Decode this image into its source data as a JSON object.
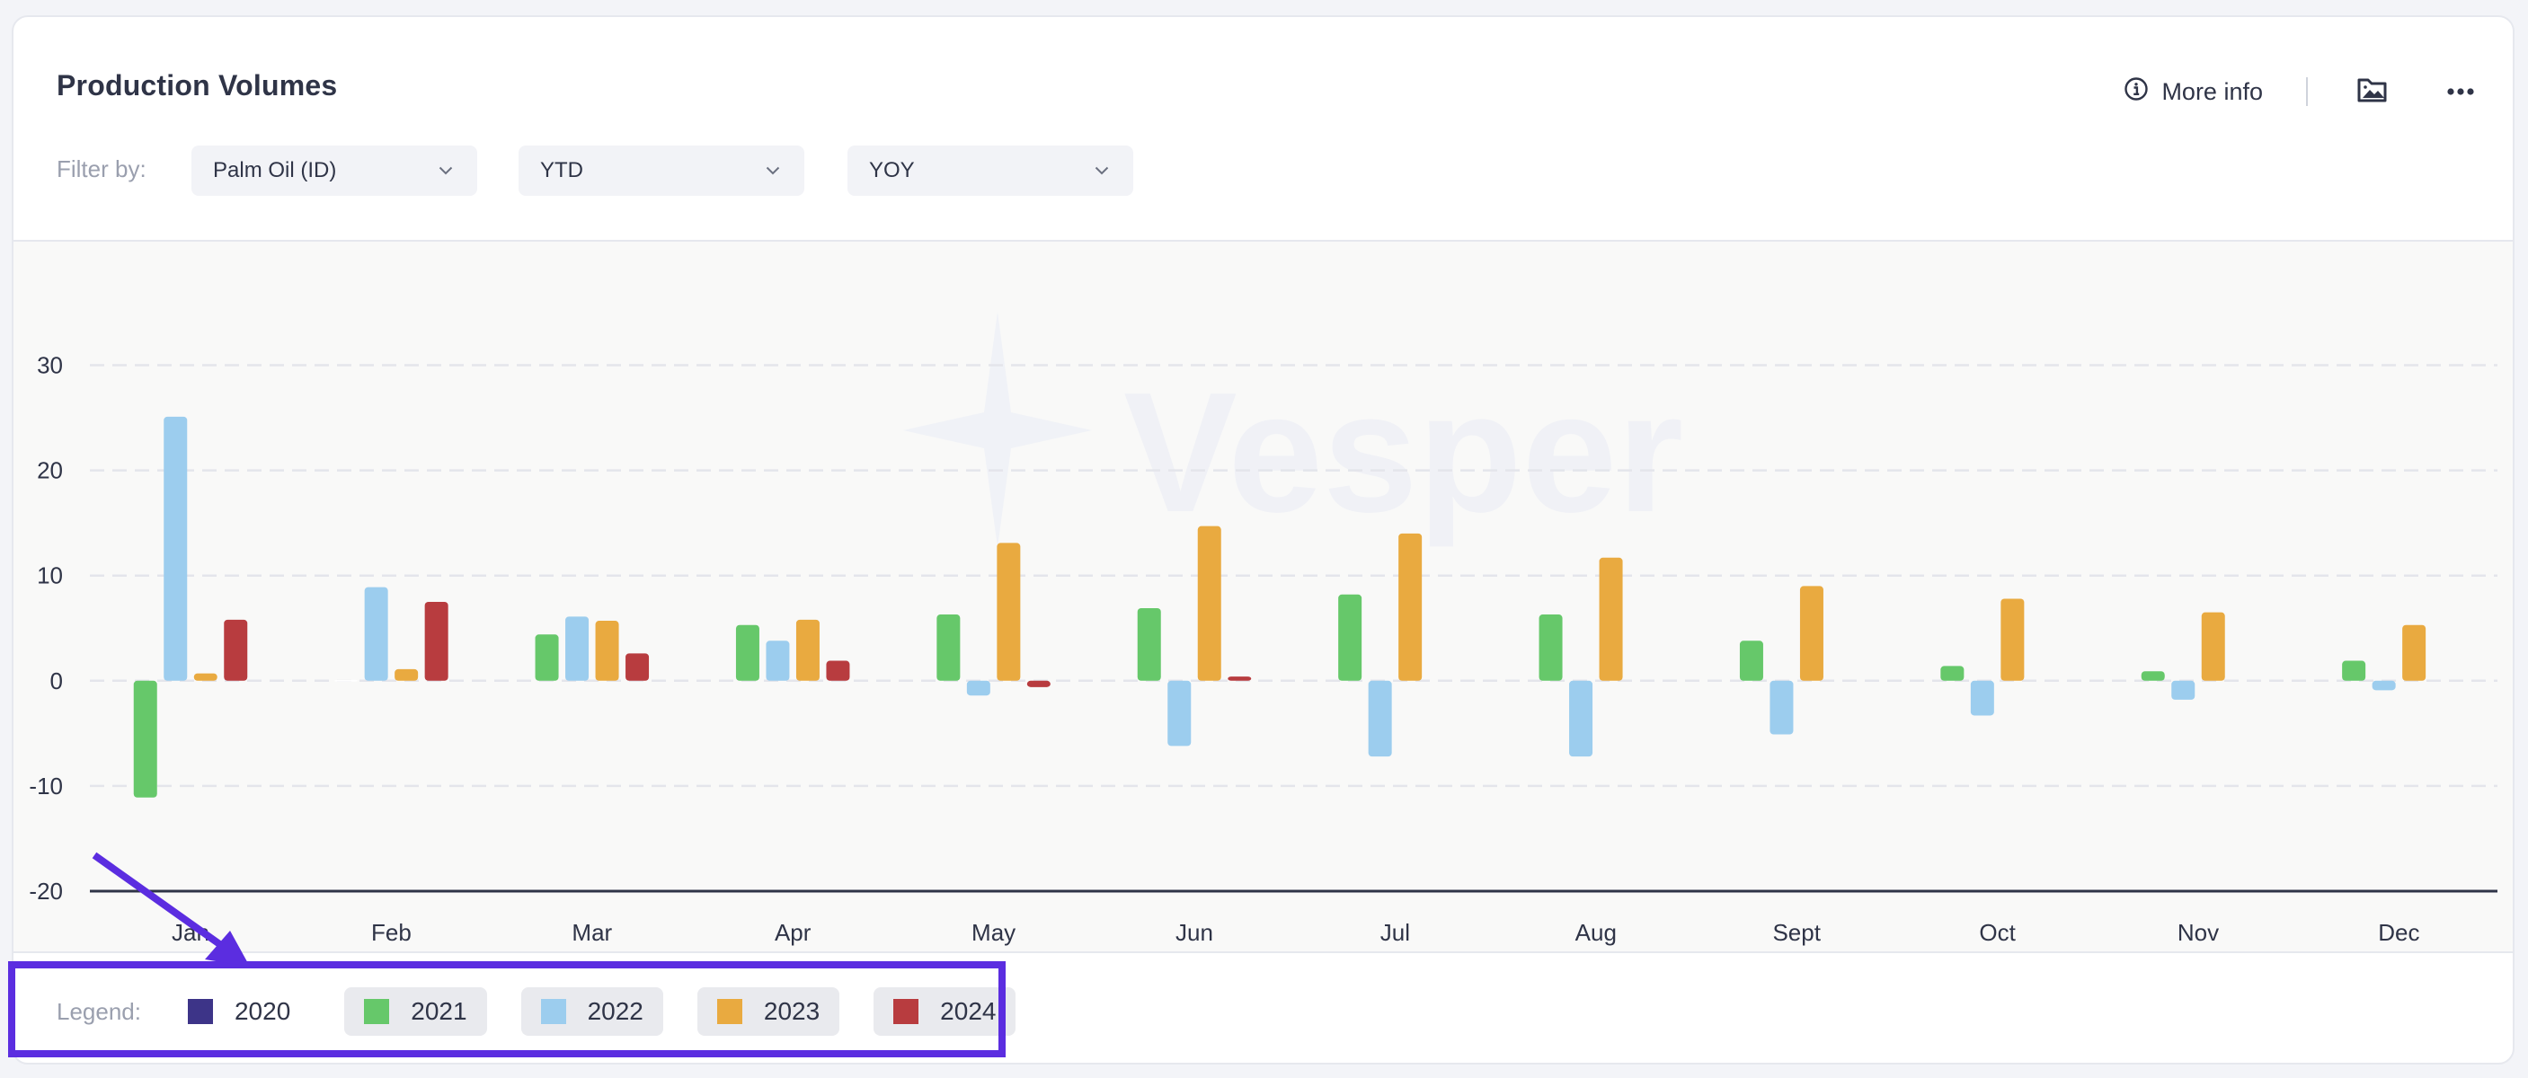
{
  "header": {
    "title": "Production Volumes",
    "more_info_label": "More info",
    "icons": {
      "info": "info-circle-icon",
      "image": "image-folder-icon",
      "more": "more-horizontal-icon"
    }
  },
  "filters": {
    "label": "Filter by:",
    "dropdowns": [
      {
        "value": "Palm Oil (ID)"
      },
      {
        "value": "YTD"
      },
      {
        "value": "YOY"
      }
    ]
  },
  "watermark": "Vesper",
  "legend": {
    "label": "Legend:",
    "items": [
      {
        "label": "2020",
        "color": "#3d3488",
        "active": false
      },
      {
        "label": "2021",
        "color": "#66c86a",
        "active": true
      },
      {
        "label": "2022",
        "color": "#9ccdee",
        "active": true
      },
      {
        "label": "2023",
        "color": "#e9aa40",
        "active": true
      },
      {
        "label": "2024",
        "color": "#b83c3f",
        "active": true
      }
    ]
  },
  "annotation": {
    "color": "#5b2de0"
  },
  "chart_data": {
    "type": "bar",
    "title": "Production Volumes",
    "xlabel": "",
    "ylabel": "",
    "ylim": [
      -20,
      30
    ],
    "yticks": [
      30,
      20,
      10,
      0,
      -10,
      -20
    ],
    "grid": true,
    "legend_position": "bottom-left",
    "categories": [
      "Jan",
      "Feb",
      "Mar",
      "Apr",
      "May",
      "Jun",
      "Jul",
      "Aug",
      "Sept",
      "Oct",
      "Nov",
      "Dec"
    ],
    "series": [
      {
        "name": "2021",
        "color": "#66c86a",
        "values": [
          -11.1,
          0,
          4.4,
          5.3,
          6.3,
          6.9,
          8.2,
          6.3,
          3.8,
          1.4,
          0.9,
          1.9
        ]
      },
      {
        "name": "2022",
        "color": "#9ccdee",
        "values": [
          25.1,
          8.9,
          6.1,
          3.8,
          -1.4,
          -6.2,
          -7.2,
          -7.2,
          -5.1,
          -3.3,
          -1.8,
          -0.9
        ]
      },
      {
        "name": "2023",
        "color": "#e9aa40",
        "values": [
          0.7,
          1.1,
          5.7,
          5.8,
          13.1,
          14.7,
          14.0,
          11.7,
          9.0,
          7.8,
          6.5,
          5.3
        ]
      },
      {
        "name": "2024",
        "color": "#b83c3f",
        "values": [
          5.8,
          7.5,
          2.6,
          1.9,
          -0.6,
          0.4,
          null,
          null,
          null,
          null,
          null,
          null
        ]
      }
    ]
  }
}
